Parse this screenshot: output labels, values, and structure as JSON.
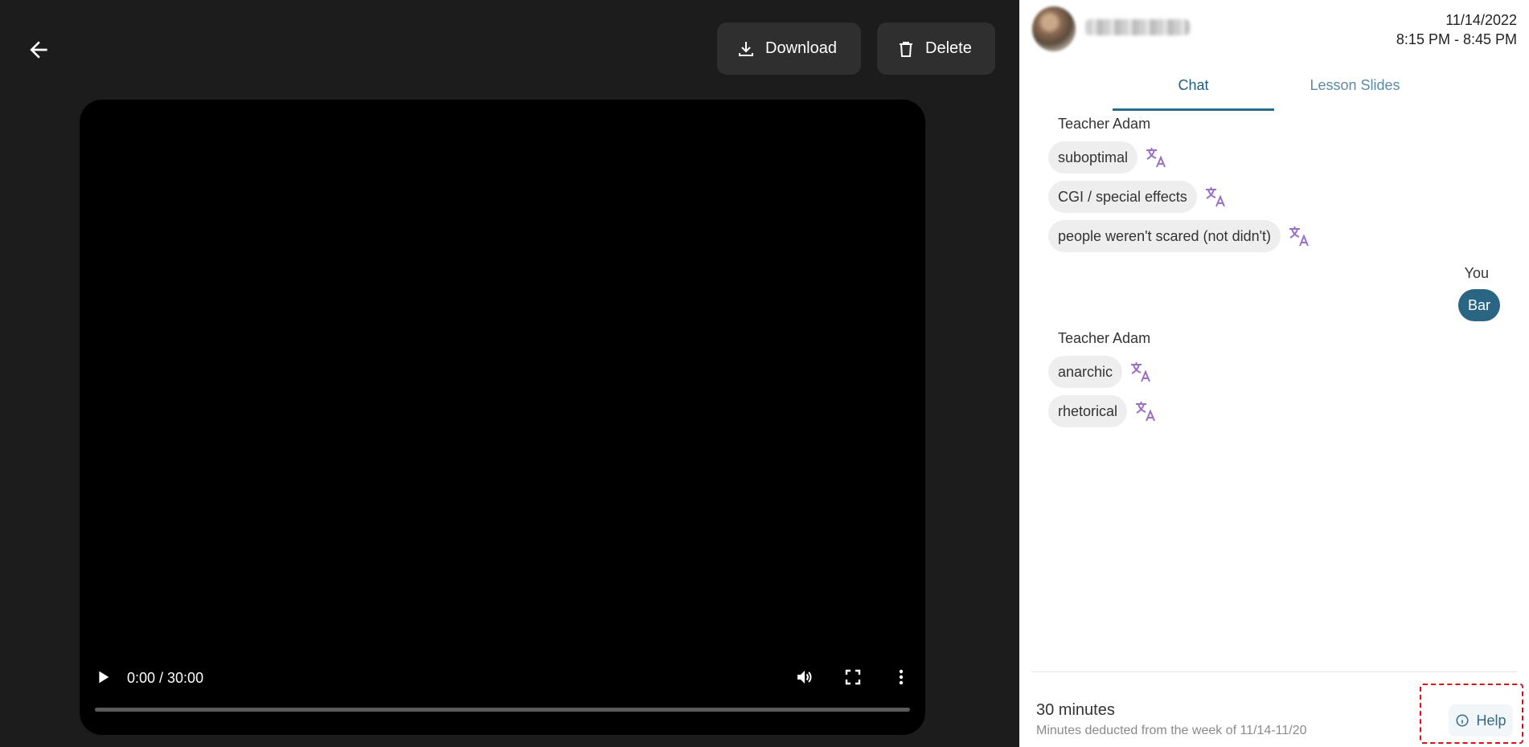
{
  "toolbar": {
    "download_label": "Download",
    "delete_label": "Delete"
  },
  "video": {
    "time": "0:00 / 30:00",
    "progress_fraction": 0
  },
  "header": {
    "date": "11/14/2022",
    "time_range": "8:15 PM - 8:45 PM"
  },
  "tabs": [
    {
      "label": "Chat",
      "active": true
    },
    {
      "label": "Lesson Slides",
      "active": false
    }
  ],
  "chat": {
    "group1_sender": "Teacher Adam",
    "group1_messages": [
      "suboptimal",
      "CGI / special effects",
      "people weren't scared (not didn't)"
    ],
    "you_sender": "You",
    "you_message": "Bar",
    "group2_sender": "Teacher Adam",
    "group2_messages": [
      "anarchic",
      "rhetorical"
    ]
  },
  "footer": {
    "minutes": "30 minutes",
    "note": "Minutes deducted from the week of 11/14-11/20",
    "help_label": "Help"
  },
  "colors": {
    "accent": "#2a6584",
    "translate_icon": "#9b6fc7",
    "focus_outline": "#d9101a"
  },
  "icons": [
    "arrow-left-icon",
    "download-icon",
    "trash-icon",
    "play-icon",
    "volume-icon",
    "fullscreen-icon",
    "more-vertical-icon",
    "translate-icon",
    "info-icon"
  ]
}
